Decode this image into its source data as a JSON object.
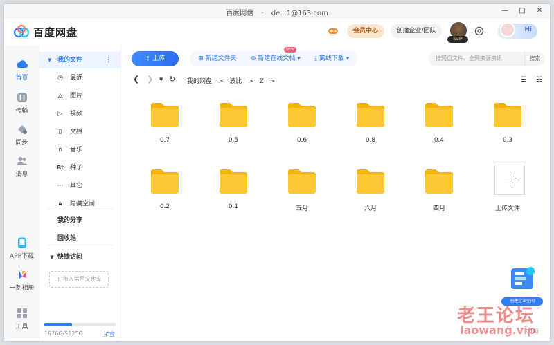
{
  "window": {
    "title": "百度网盘",
    "account": "de...1@163.com",
    "controls": [
      "—",
      "□",
      "✕"
    ]
  },
  "header": {
    "logo_text": "百度网盘",
    "vip_label": "会员中心",
    "enterprise_label": "创建企业/团队",
    "svip_badge": "SVIP",
    "hi_label": "Hi"
  },
  "leftnav": {
    "items": [
      {
        "label": "首页",
        "icon": "cloud-icon"
      },
      {
        "label": "传输",
        "icon": "transfer-icon"
      },
      {
        "label": "同步",
        "icon": "sync-icon"
      },
      {
        "label": "消息",
        "icon": "message-icon"
      },
      {
        "label": "APP下载",
        "icon": "phone-icon"
      },
      {
        "label": "一刻相册",
        "icon": "album-icon"
      },
      {
        "label": "工具",
        "icon": "tools-icon"
      }
    ]
  },
  "sidebar": {
    "my_files": "我的文件",
    "sub_items": [
      {
        "label": "最近",
        "icon": "clock-icon"
      },
      {
        "label": "图片",
        "icon": "image-icon"
      },
      {
        "label": "视频",
        "icon": "video-icon"
      },
      {
        "label": "文档",
        "icon": "document-icon"
      },
      {
        "label": "音乐",
        "icon": "headphones-icon"
      },
      {
        "label": "种子",
        "icon": "bt-icon"
      },
      {
        "label": "其它",
        "icon": "more-icon"
      },
      {
        "label": "隐藏空间",
        "icon": "lock-icon"
      }
    ],
    "my_share": "我的分享",
    "recycle": "回收站",
    "quick_access": "快捷访问",
    "drop_hint": "+ 拖入常用文件夹",
    "storage": {
      "text": "1976G/5125G",
      "fraction": 0.386,
      "expand": "扩容"
    }
  },
  "toolbar": {
    "upload": "上传",
    "new_folder": "新建文件夹",
    "new_doc": "新建在线文档",
    "new_badge": "NEW",
    "offline": "离线下载",
    "search_placeholder": "搜网盘文件、全网资源资讯",
    "search_btn": "搜索"
  },
  "breadcrumb": {
    "items": [
      "我的网盘",
      ">",
      "波比",
      ">",
      "Z",
      ">"
    ]
  },
  "files": [
    {
      "name": "0.7",
      "type": "folder"
    },
    {
      "name": "0.5",
      "type": "folder"
    },
    {
      "name": "0.6",
      "type": "folder"
    },
    {
      "name": "0.8",
      "type": "folder"
    },
    {
      "name": "0.4",
      "type": "folder"
    },
    {
      "name": "0.3",
      "type": "folder"
    },
    {
      "name": "0.2",
      "type": "folder"
    },
    {
      "name": "0.1",
      "type": "folder"
    },
    {
      "name": "五月",
      "type": "folder"
    },
    {
      "name": "六月",
      "type": "folder"
    },
    {
      "name": "四月",
      "type": "folder"
    },
    {
      "name": "上传文件",
      "type": "upload"
    }
  ],
  "promo": {
    "label": "创建企业空间"
  },
  "count": "11项",
  "watermark": {
    "line1": "老王论坛",
    "line2": "laowang.vip"
  }
}
